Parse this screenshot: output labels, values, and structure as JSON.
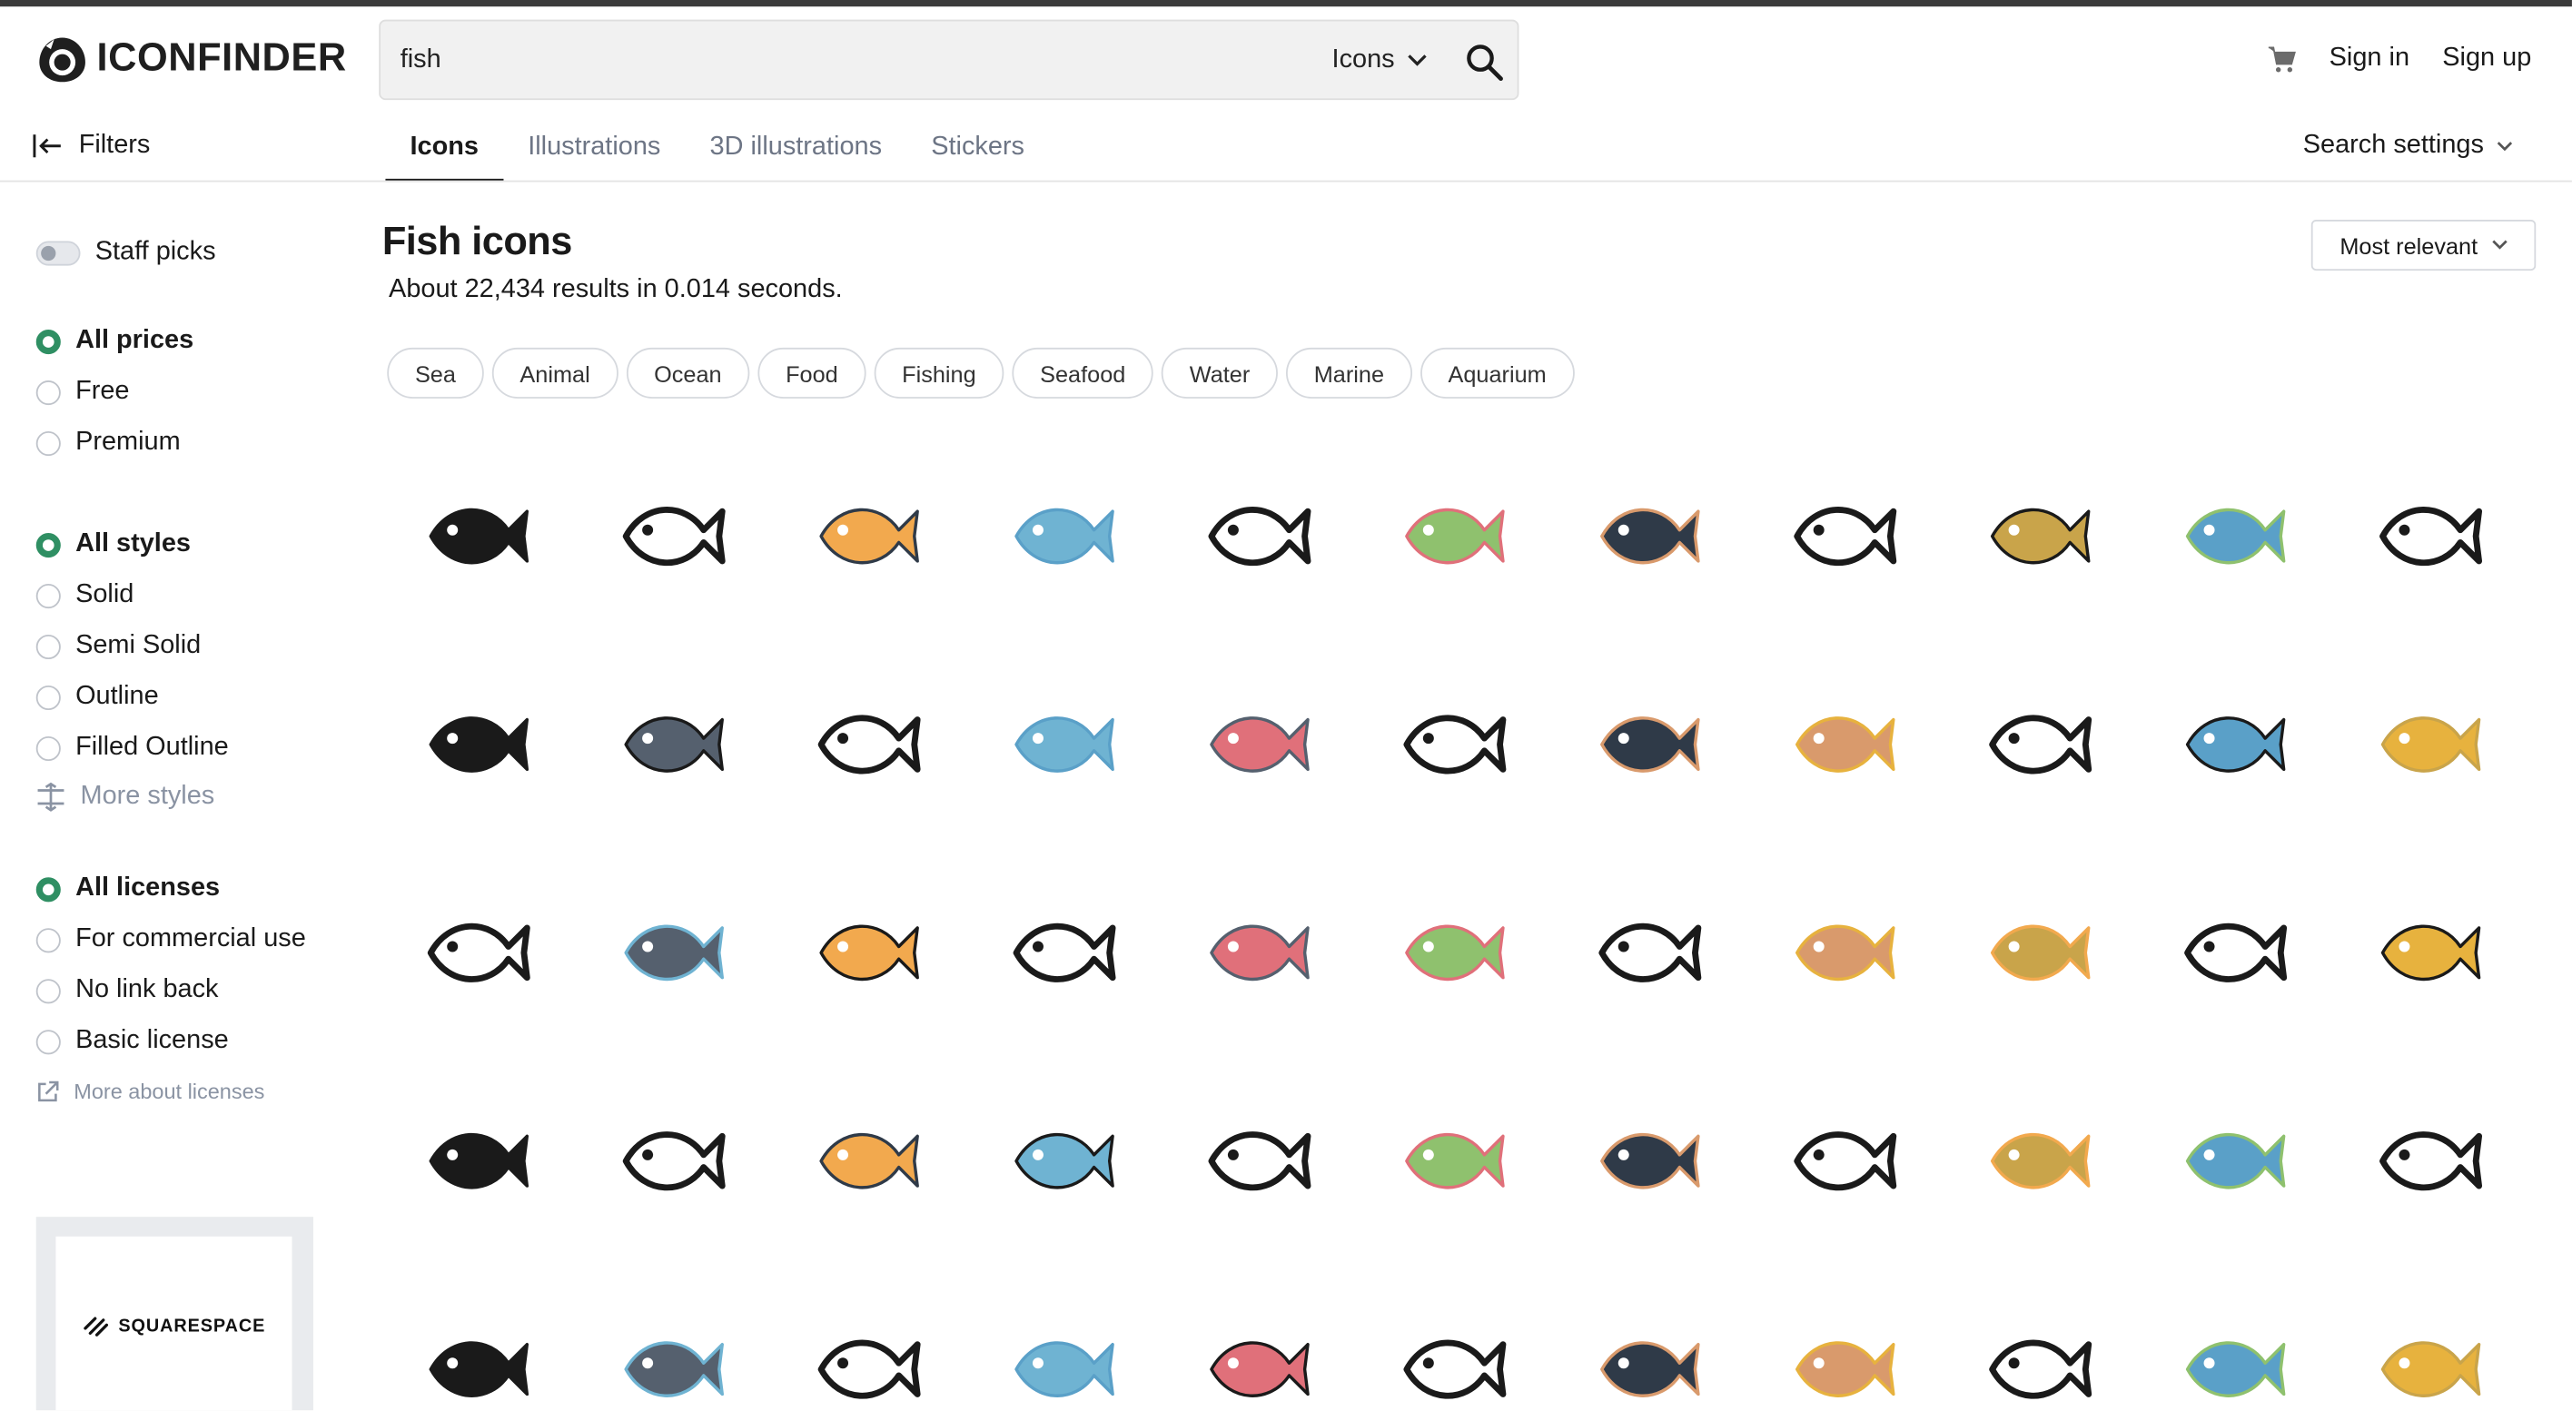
{
  "header": {
    "logo_text": "ICONFINDER",
    "search_value": "fish",
    "search_type": "Icons",
    "sign_in": "Sign in",
    "sign_up": "Sign up"
  },
  "nav": {
    "filters_label": "Filters",
    "tabs": [
      {
        "label": "Icons",
        "active": true
      },
      {
        "label": "Illustrations",
        "active": false
      },
      {
        "label": "3D illustrations",
        "active": false
      },
      {
        "label": "Stickers",
        "active": false
      }
    ],
    "search_settings": "Search settings"
  },
  "sidebar": {
    "staff_picks": "Staff picks",
    "prices": [
      "All prices",
      "Free",
      "Premium"
    ],
    "styles": [
      "All styles",
      "Solid",
      "Semi Solid",
      "Outline",
      "Filled Outline"
    ],
    "more_styles": "More styles",
    "licenses": [
      "All licenses",
      "For commercial use",
      "No link back",
      "Basic license"
    ],
    "more_licenses": "More about licenses",
    "ad_text": "SQUARESPACE"
  },
  "main": {
    "title": "Fish icons",
    "results": "About 22,434 results in 0.014 seconds.",
    "sort": "Most relevant",
    "chips": [
      "Sea",
      "Animal",
      "Ocean",
      "Food",
      "Fishing",
      "Seafood",
      "Water",
      "Marine",
      "Aquarium"
    ]
  },
  "icons": [
    [
      "fish-flat-icon",
      "fish-solid-icon",
      "fish-hook-waves-icon",
      "dolphin-flat-icon",
      "fish-outline-icon",
      "whale-solid-icon",
      "fish-solid-icon",
      "fish-line-icon",
      "fish-school-icon",
      "dolphin-outline-icon",
      "fish-number-icon"
    ],
    [
      "carp-outline-icon",
      "sushi-board-icon",
      "fish-bone-icon",
      "ichthys-icon",
      "stingray-icon",
      "small-fish-icon",
      "fish-jumping-icon",
      "grouper-outline-icon",
      "fish-on-hook-icon",
      "sea-cucumber-icon",
      "koinobori-icon"
    ],
    [
      "koi-fish-icon",
      "fish-eye-icon",
      "fisherman-icon",
      "pufferfish-icon",
      "anglerfish-icon",
      "sushi-icon",
      "worm-icon",
      "blowfish-icon",
      "crab-icon",
      "clownfish-icon",
      "eel-icon"
    ],
    [
      "koi-waves-icon",
      "anglerfish-dark-icon",
      "fish-sketch-icon",
      "seahorse-icon",
      "dolphin-icon",
      "fish-bubbles-icon",
      "fish-group-icon",
      "fishing-rod-icon",
      "fish-line2-icon",
      "hook-icon",
      "shark-icon"
    ],
    [
      "starfish-icon",
      "whale-tail-icon",
      "koi-pair-icon",
      "yellow-fish-icon",
      "fish-dark-icon",
      "angelfish-icon",
      "leaf-fish-icon",
      "fishbowl-icon",
      "catfish-icon",
      "sunfish-icon",
      "fish-plate-icon"
    ]
  ],
  "colors": {
    "accent_green": "#2f8f63",
    "muted_text": "#6d7585"
  }
}
